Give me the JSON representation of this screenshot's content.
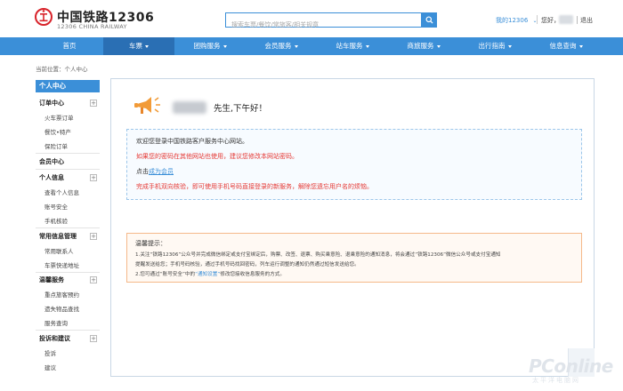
{
  "header": {
    "logo_text": "中国铁路12306",
    "logo_sub": "12306 CHINA RAILWAY",
    "search_placeholder": "搜索车票/餐饮/常旅客/相关规章",
    "my12306": "我的12306",
    "greeting": "您好，",
    "logout": "退出"
  },
  "nav": {
    "items": [
      {
        "label": "首页",
        "caret": false
      },
      {
        "label": "车票",
        "caret": true,
        "active": true
      },
      {
        "label": "团购服务",
        "caret": true
      },
      {
        "label": "会员服务",
        "caret": true
      },
      {
        "label": "站车服务",
        "caret": true
      },
      {
        "label": "商旅服务",
        "caret": true
      },
      {
        "label": "出行指南",
        "caret": true
      },
      {
        "label": "信息查询",
        "caret": true
      }
    ]
  },
  "breadcrumb": "当前位置：个人中心",
  "sidebar": {
    "title": "个人中心",
    "groups": [
      {
        "label": "订单中心",
        "plus": true,
        "items": [
          "火车票订单",
          "餐饮•特产",
          "保险订单"
        ]
      },
      {
        "label": "会员中心",
        "plus": false,
        "items": []
      },
      {
        "label": "个人信息",
        "plus": true,
        "items": [
          "查看个人信息",
          "账号安全",
          "手机核验"
        ]
      },
      {
        "label": "常用信息管理",
        "plus": true,
        "items": [
          "常用联系人",
          "车票快递地址"
        ]
      },
      {
        "label": "温馨服务",
        "plus": true,
        "items": [
          "重点旅客预约",
          "遗失物品查找",
          "服务查询"
        ]
      },
      {
        "label": "投诉和建议",
        "plus": true,
        "items": [
          "投诉",
          "建议"
        ]
      }
    ]
  },
  "main": {
    "greeting": "先生,下午好！",
    "welcome": "欢迎您登录中国铁路客户服务中心网站。",
    "password_warning": "如果您的密码在其他网站也使用，建议您修改本网站密码。",
    "click_prefix": "点击",
    "member_link": "成为会员",
    "phone_notice": "完成手机双向核验，即可使用手机号码直接登录的新服务，解除您遗忘用户名的烦恼。",
    "tips_title": "温馨提示：",
    "tip1_line1": "1.关注“铁路12306”公众号并完成微信绑定或支付宝绑定后，购票、改签、退票、购买乘意险、退乘意险的通知消息，将会通过“铁路12306”微信公众号或支付宝通知",
    "tip1_line2": "提醒发送给您；手机号码核验，通过手机号码找回密码，列车运行调整的通知仍然通过短信发送给您。",
    "tip2_prefix": "2.您可通过“账号安全”中的",
    "tip2_link": "“通知设置”",
    "tip2_suffix": "修改您接收信息服务的方式。"
  },
  "watermark": {
    "text": "PConline",
    "sub": "太平洋电脑网"
  },
  "colors": {
    "brand_blue": "#3b8fd8",
    "nav_active": "#2a6fb4",
    "warning_red": "#e53935",
    "tip_border": "#f5b98a",
    "logo_red": "#d8232a"
  }
}
